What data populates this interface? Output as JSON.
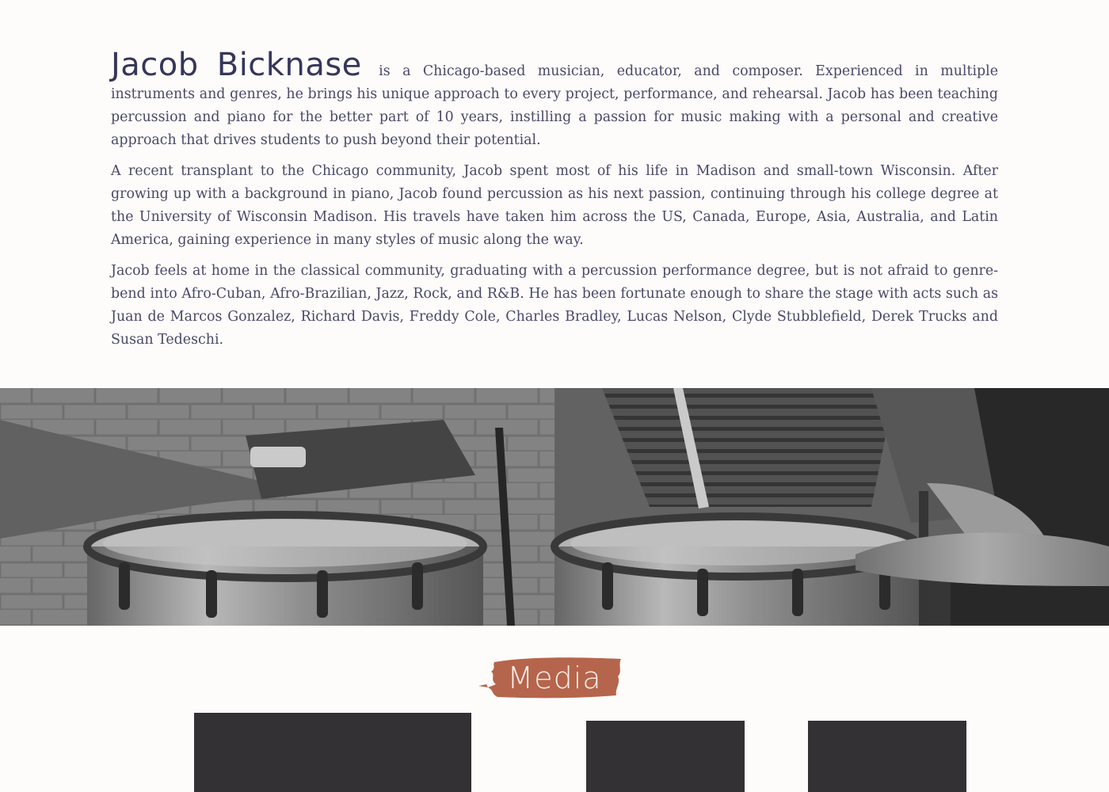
{
  "bio": {
    "name": "Jacob Bicknase",
    "intro": " is a Chicago-based musician, educator, and composer. Experienced in multiple instruments and genres, he brings his unique approach to every project, performance, and rehearsal. Jacob has been teaching percussion and piano for the better part of 10 years, instilling a passion for music making with a personal and creative approach that drives students to push beyond their potential.",
    "paragraph2": "A recent transplant to the Chicago community, Jacob spent most of his life in Madison and small-town Wisconsin. After growing up with a background in piano, Jacob found percussion as his next passion, continuing through his college degree at the University of Wisconsin Madison. His travels have taken him across the US, Canada, Europe, Asia, Australia, and Latin America, gaining experience in many styles of music along the way.",
    "paragraph3": "Jacob feels at home in the classical community, graduating with a percussion performance degree, but is not afraid to genre-bend into Afro-Cuban, Afro-Brazilian, Jazz, Rock, and R&B. He has been fortunate enough to share the stage with acts such as Juan de Marcos Gonzalez, Richard Davis, Freddy Cole, Charles Bradley, Lucas Nelson, Clyde Stubblefield, Derek Trucks and Susan Tedeschi."
  },
  "media": {
    "heading": "Media"
  },
  "colors": {
    "background": "#fdfcfb",
    "text": "#4a4866",
    "brush_accent": "#b5654b",
    "tile": "#333134"
  }
}
